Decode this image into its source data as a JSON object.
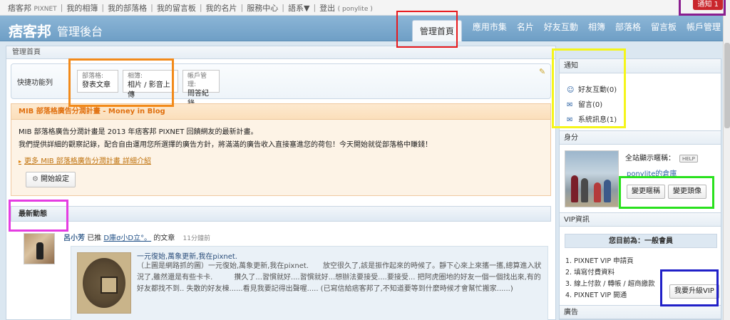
{
  "topbar": {
    "links": [
      "痞客邦",
      "我的相簿",
      "我的部落格",
      "我的留言板",
      "我的名片",
      "服務中心",
      "語系▼",
      "登出"
    ],
    "brand_sub": "PIXNET",
    "user_sub": "( ponylite )",
    "notify": "通知 1"
  },
  "header": {
    "logo": "痞客邦",
    "subtitle": "管理後台",
    "tabs": [
      "管理首頁",
      "應用市集",
      "名片",
      "好友互動",
      "相簿",
      "部落格",
      "留言板",
      "帳戶管理"
    ]
  },
  "main": {
    "title": "管理首頁",
    "quick": {
      "label": "快捷功能列",
      "buttons": [
        {
          "cat": "部落格:",
          "act": "發表文章"
        },
        {
          "cat": "相簿:",
          "act": "相片 / 影音上傳"
        },
        {
          "cat": "帳戶管理:",
          "act": "問答紀錄"
        }
      ]
    },
    "mib": {
      "title": "MIB 部落格廣告分潤計畫 - Money in Blog",
      "line1": "MIB 部落格廣告分潤計畫是 2013 年痞客邦 PIXNET 回饋網友的最新計畫。",
      "line2": "我們提供詳細的觀察記錄，配合自由運用您所選擇的廣告方針，將滿滿的廣告收入直接塞進您的荷包！今天開始就從部落格中賺錢！",
      "link": "更多 MIB 部落格廣告分潤計畫 詳細介紹",
      "button": "開始設定"
    },
    "news": {
      "title": "最新動態",
      "user": "呂小芳",
      "verb": "已推",
      "article": "D庫σ小D立°。",
      "suffix": "的文章",
      "time": "11分鐘前",
      "card_title": "一元復始,萬象更新,我在pixnet.",
      "card_body": "（上圖是網路抓的圖）一元復始,萬象更新,我在pixnet.　　放空很久了,該是振作起來的時候了。靜下心來上來攜一攜,總算進入狀況了,雖然還是有些卡卡.　　　攢久了...習慣就好....習慣就好...想辦法要接受....要接受... 把阿虎圈地的好友一個一個找出來,有的好友都找不到.. 失散的好友棟......看見我要記得出聲喔..... (已寫信給痞客邦了,不知道要等到什麼時候才會幫忙搬家......)"
    }
  },
  "right": {
    "notify_title": "通知",
    "notify_items": [
      "好友互動(0)",
      "留言(0)",
      "系統訊息(1)"
    ],
    "profile_title": "身分",
    "nick_label": "全站顯示暱稱：",
    "help": "HELP",
    "nick_value": "ponylite的倉庫",
    "btn_nick": "變更暱稱",
    "btn_avatar": "變更頭像",
    "vip_title": "VIP資訊",
    "vip_status": "您目前為：一般會員",
    "vip_lines": [
      "1. PIXNET VIP 申請頁",
      "2. 填寫付費資料",
      "3. 線上付款 / 轉帳 / 超商繳款",
      "4. PIXNET VIP 開通"
    ],
    "vip_button": "我要升級VIP",
    "ad_title": "廣告"
  },
  "colors": {
    "accent": "#6f9fc6",
    "mib_title": "#e0700f",
    "notify_badge": "#c9262c"
  }
}
